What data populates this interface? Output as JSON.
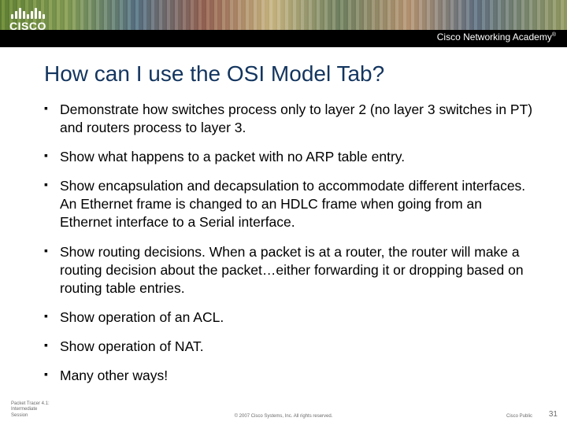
{
  "brand": {
    "name": "CISCO",
    "academy": "Cisco Networking Academy",
    "tm": "®"
  },
  "title": "How can I use the OSI Model Tab?",
  "bullets": [
    "Demonstrate how switches process only to layer 2 (no layer 3 switches in PT) and routers process to layer 3.",
    "Show what happens to a packet with no ARP table entry.",
    "Show encapsulation and decapsulation to accommodate different interfaces. An Ethernet frame is changed to an HDLC frame when going from an Ethernet interface to a Serial interface.",
    "Show routing decisions. When a packet is at a router, the router will make a routing decision about the packet…either forwarding it or dropping based on routing table entries.",
    "Show operation of an ACL.",
    "Show operation of NAT.",
    "Many other ways!"
  ],
  "footer": {
    "left_line1": "Packet Tracer 4.1:",
    "left_line2": "Intermediate",
    "left_line3": "Session",
    "mid": "© 2007 Cisco Systems, Inc. All rights reserved.",
    "right": "Cisco Public",
    "num": "31"
  }
}
